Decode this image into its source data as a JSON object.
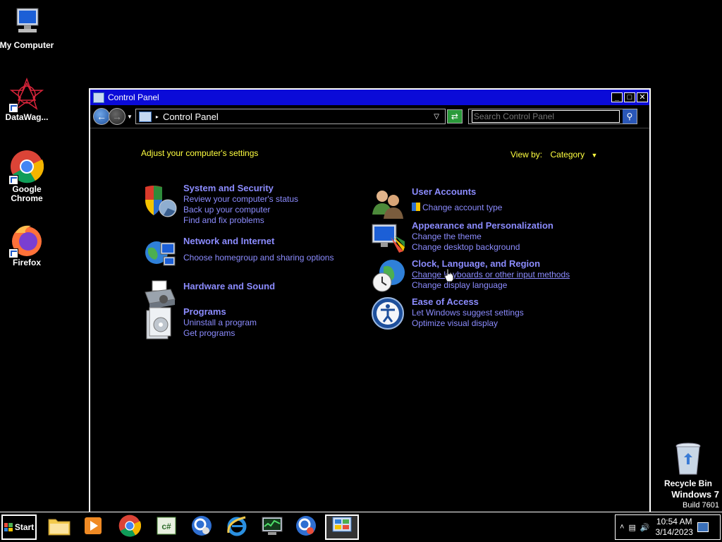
{
  "desktop": {
    "icons": [
      {
        "label": "My Computer",
        "icon": "my-computer-icon"
      },
      {
        "label": "DataWag...",
        "icon": "datawag-icon"
      },
      {
        "label": "Google Chrome",
        "icon": "chrome-icon"
      },
      {
        "label": "Firefox",
        "icon": "firefox-icon"
      }
    ],
    "recycle_bin": "Recycle Bin",
    "watermark_line1": "Windows 7",
    "watermark_line2": "Build 7601"
  },
  "window": {
    "title": "Control Panel",
    "buttons": {
      "minimize": "_",
      "maximize": "□",
      "close": "✕"
    },
    "address": {
      "location": "Control Panel"
    },
    "search": {
      "placeholder": "Search Control Panel"
    }
  },
  "control_panel": {
    "heading": "Adjust your computer's settings",
    "view_by_label": "View by:",
    "view_by_value": "Category",
    "categories": [
      {
        "title": "System and Security",
        "links": [
          "Review your computer's status",
          "Back up your computer",
          "Find and fix problems"
        ],
        "icon": "shield-icon"
      },
      {
        "title": "Network and Internet",
        "links": [
          "Choose homegroup and sharing options"
        ],
        "icon": "network-globe-icon"
      },
      {
        "title": "Hardware and Sound",
        "links": [],
        "icon": "printer-icon"
      },
      {
        "title": "Programs",
        "links": [
          "Uninstall a program",
          "Get programs"
        ],
        "icon": "programs-icon"
      },
      {
        "title": "User Accounts",
        "links": [
          "Change account type"
        ],
        "icon": "users-icon"
      },
      {
        "title": "Appearance and Personalization",
        "links": [
          "Change the theme",
          "Change desktop background"
        ],
        "icon": "monitor-paint-icon"
      },
      {
        "title": "Clock, Language, and Region",
        "links": [
          "Change keyboards or other input methods",
          "Change display language"
        ],
        "icon": "clock-globe-icon"
      },
      {
        "title": "Ease of Access",
        "links": [
          "Let Windows suggest settings",
          "Optimize visual display"
        ],
        "icon": "ease-of-access-icon"
      }
    ]
  },
  "taskbar": {
    "start_label": "Start",
    "pinned": [
      "explorer-folder-icon",
      "media-player-icon",
      "chrome-icon",
      "csharp-icon",
      "search-app-icon",
      "internet-explorer-icon",
      "task-monitor-icon",
      "search-app-2-icon",
      "control-panel-icon"
    ],
    "clock_time": "10:54 AM",
    "clock_date": "3/14/2023"
  },
  "colors": {
    "title_bar": "#0b0bd8",
    "link": "#8c8cff",
    "heading": "#ffff40",
    "background": "#000000"
  }
}
